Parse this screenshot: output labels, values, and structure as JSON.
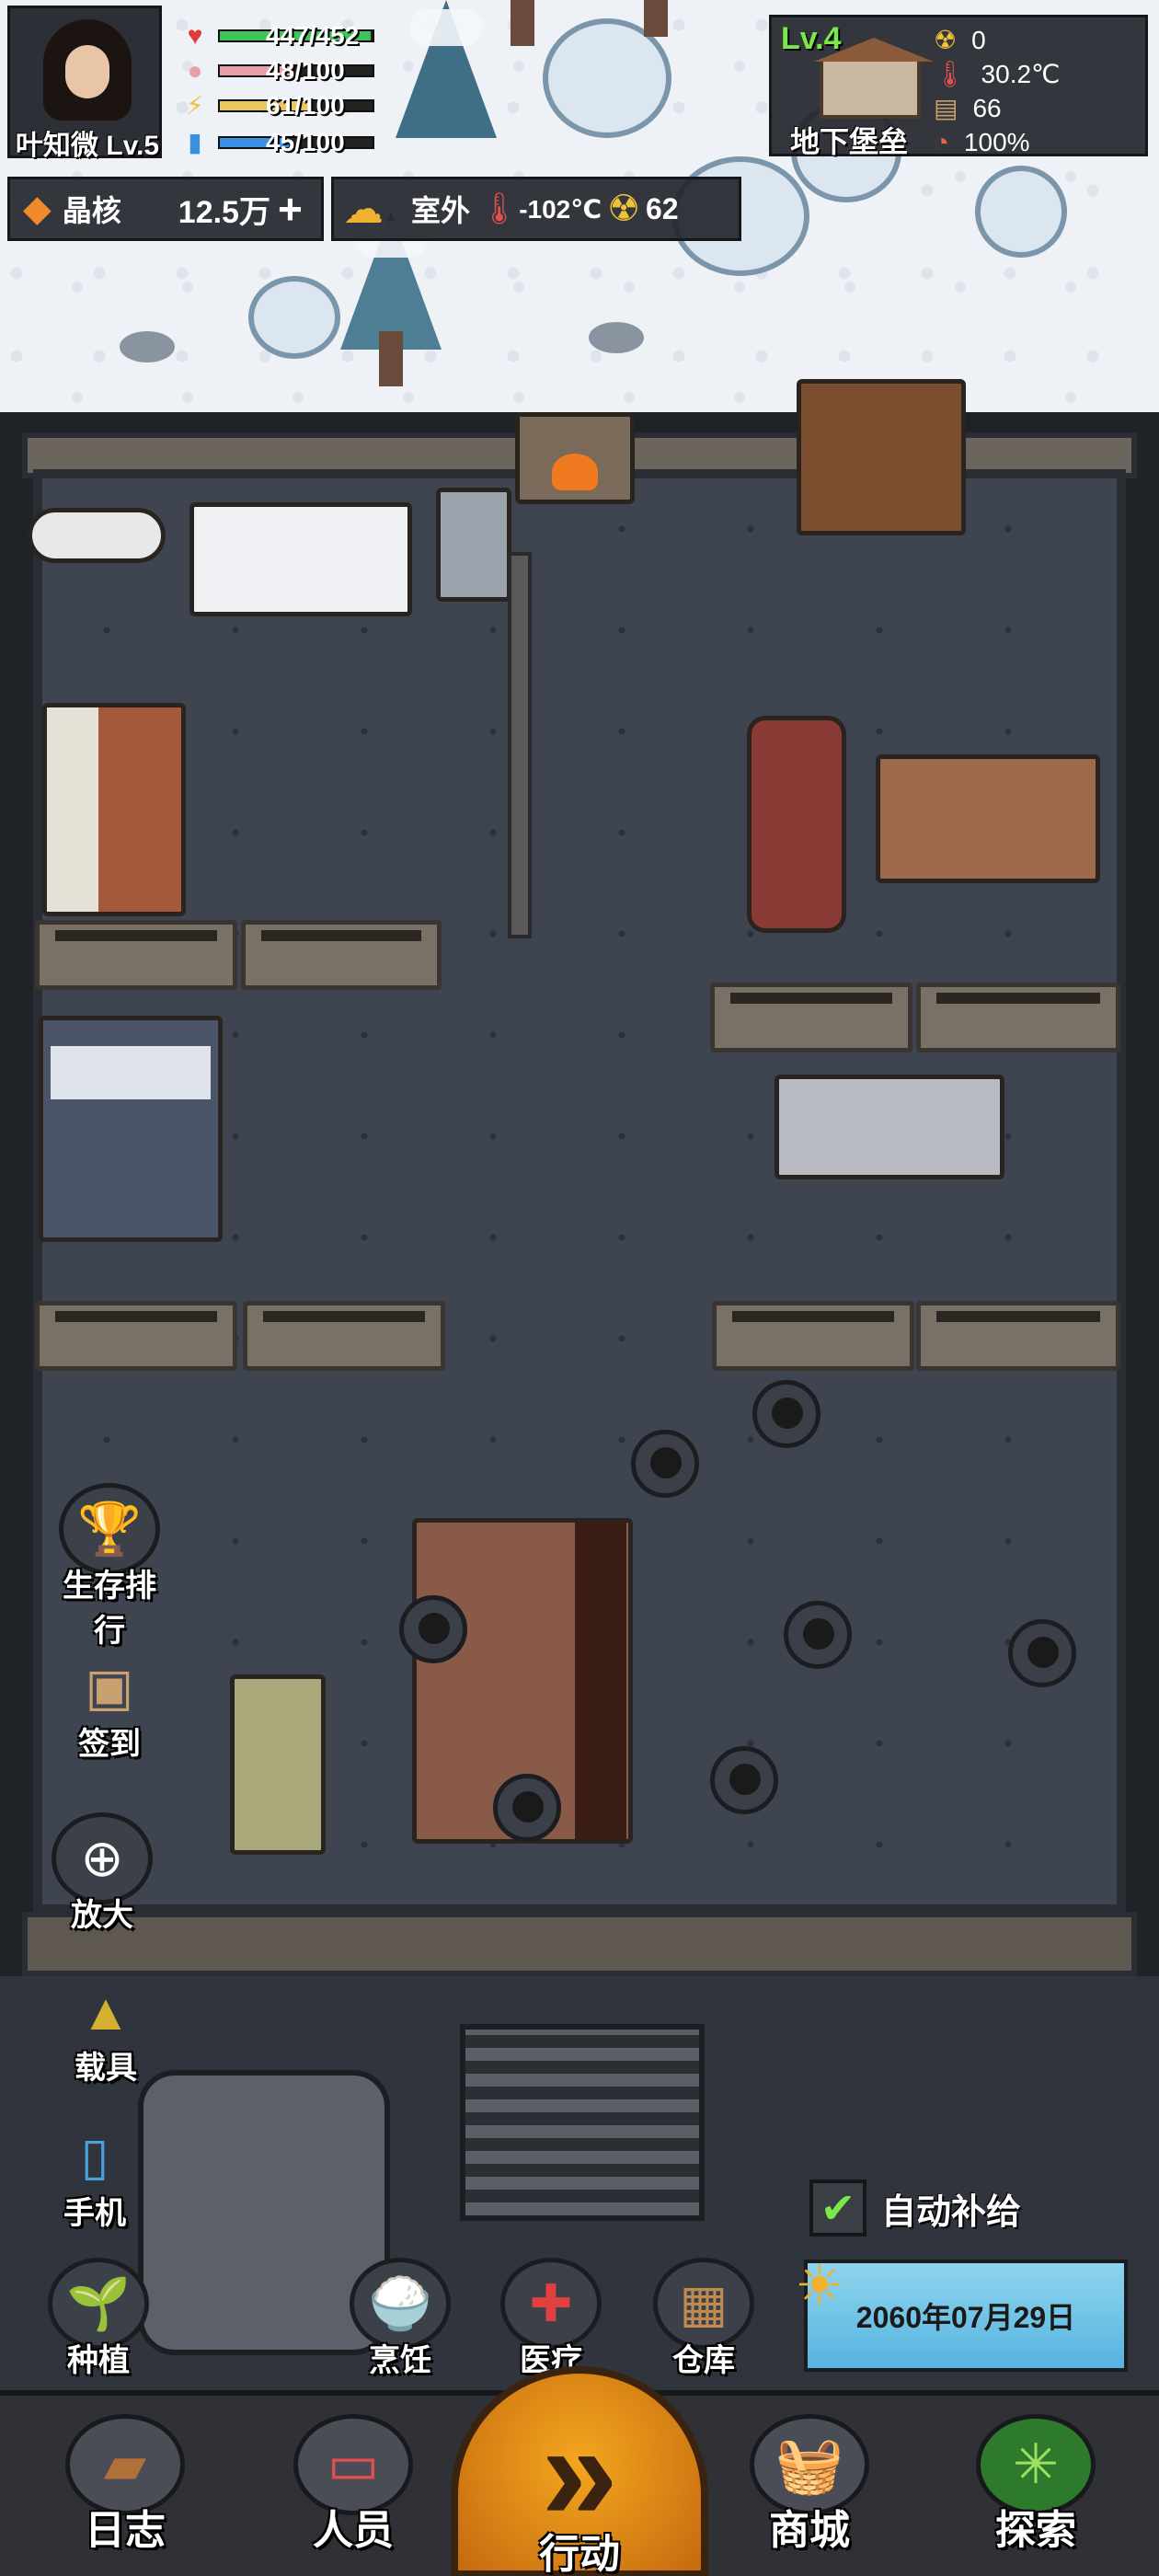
{
  "player": {
    "name_level": "叶知微 Lv.5",
    "hp": "447/452",
    "hp_ratio": 0.99,
    "food": "48/100",
    "food_ratio": 0.48,
    "energy": "61/100",
    "energy_ratio": 0.61,
    "water": "45/100",
    "water_ratio": 0.45,
    "colors": {
      "hp": "#3fc25a",
      "food": "#e9a0a8",
      "energy": "#e8c660",
      "water": "#3a8fe0"
    }
  },
  "base": {
    "level": "Lv.4",
    "name": "地下堡垒",
    "radiation": "0",
    "temperature": "30.2℃",
    "supplies": "66",
    "integrity": "100%"
  },
  "resources": {
    "crystal_label": "晶核",
    "crystal_value": "12.5万",
    "add_symbol": "+",
    "outdoor_label": "室外",
    "outdoor_temp": "-102℃",
    "outdoor_radiation": "62"
  },
  "side_buttons": {
    "ranking": "生存排行",
    "checkin": "签到",
    "zoom": "放大",
    "vehicle": "载具",
    "phone": "手机"
  },
  "action_buttons": {
    "planting": "种植",
    "cooking": "烹饪",
    "medical": "医疗",
    "storage": "仓库"
  },
  "auto_supply": {
    "label": "自动补给",
    "checked": true,
    "check_symbol": "✔"
  },
  "date": "2060年07月29日",
  "nav": {
    "log": "日志",
    "staff": "人员",
    "action": "行动",
    "action_symbol": "»",
    "shop": "商城",
    "explore": "探索"
  }
}
